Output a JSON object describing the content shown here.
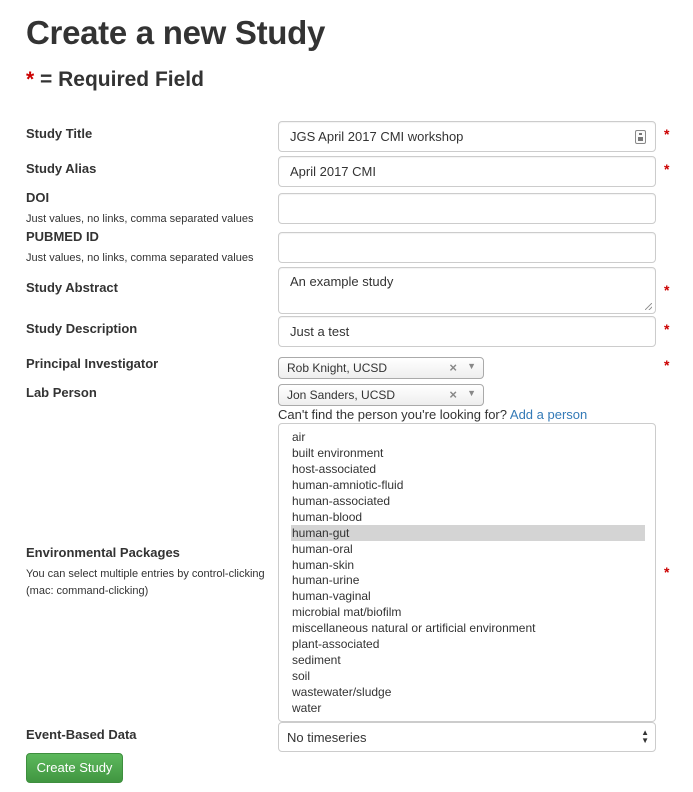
{
  "page": {
    "title": "Create a new Study",
    "required_star": "*",
    "required_legend": " = Required Field"
  },
  "fields": {
    "study_title": {
      "label": "Study Title",
      "value": "JGS April 2017 CMI workshop",
      "required": "*"
    },
    "study_alias": {
      "label": "Study Alias",
      "value": "April 2017 CMI",
      "required": "*"
    },
    "doi": {
      "label": "DOI",
      "help": "Just values, no links, comma separated values",
      "value": ""
    },
    "pubmed_id": {
      "label": "PUBMED ID",
      "help": "Just values, no links, comma separated values",
      "value": ""
    },
    "study_abstract": {
      "label": "Study Abstract",
      "value": "An example study",
      "required": "*"
    },
    "study_description": {
      "label": "Study Description",
      "value": "Just a test",
      "required": "*"
    },
    "principal_investigator": {
      "label": "Principal Investigator",
      "value": "Rob Knight, UCSD",
      "required": "*"
    },
    "lab_person": {
      "label": "Lab Person",
      "value": "Jon Sanders, UCSD"
    },
    "person_help": {
      "text": "Can't find the person you're looking for?",
      "link": "Add a person"
    },
    "environmental_packages": {
      "label": "Environmental Packages",
      "help_line1": "You can select multiple entries by control-clicking",
      "help_line2": "(mac: command-clicking)",
      "required": "*",
      "options": [
        "air",
        "built environment",
        "host-associated",
        "human-amniotic-fluid",
        "human-associated",
        "human-blood",
        "human-gut",
        "human-oral",
        "human-skin",
        "human-urine",
        "human-vaginal",
        "microbial mat/biofilm",
        "miscellaneous natural or artificial environment",
        "plant-associated",
        "sediment",
        "soil",
        "wastewater/sludge",
        "water"
      ],
      "selected": "human-gut"
    },
    "event_based_data": {
      "label": "Event-Based Data",
      "value": "No timeseries"
    }
  },
  "icons": {
    "clear": "×",
    "dropdown_arrow": "▼",
    "updown_up": "▲",
    "updown_down": "▼"
  },
  "actions": {
    "create_label": "Create Study"
  },
  "colors": {
    "required": "#cc0000",
    "link": "#337ab7",
    "button": "#5cb85c",
    "selected_option": "#d4d4d4"
  }
}
